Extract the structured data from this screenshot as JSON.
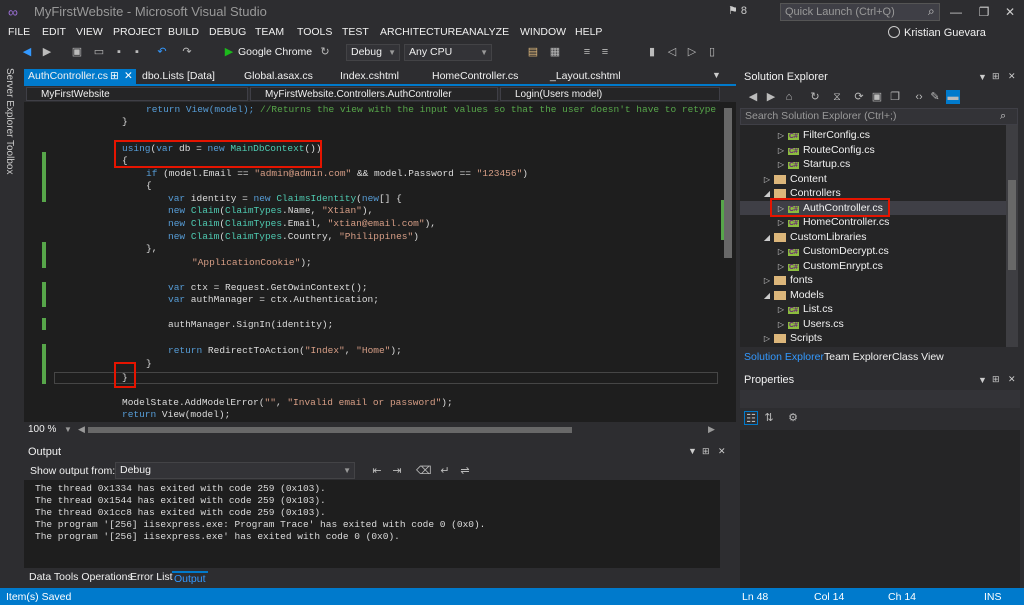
{
  "app": {
    "title": "MyFirstWebsite - Microsoft Visual Studio",
    "notifications": "8",
    "quick_launch_placeholder": "Quick Launch (Ctrl+Q)",
    "user": "Kristian Guevara"
  },
  "menu": [
    "FILE",
    "EDIT",
    "VIEW",
    "PROJECT",
    "BUILD",
    "DEBUG",
    "TEAM",
    "TOOLS",
    "TEST",
    "ARCHITECTURE",
    "ANALYZE",
    "WINDOW",
    "HELP"
  ],
  "toolbar": {
    "browser": "Google Chrome",
    "config": "Debug",
    "platform": "Any CPU"
  },
  "side_tabs": {
    "server_explorer": "Server Explorer",
    "toolbox": "Toolbox"
  },
  "tabs": [
    "AuthController.cs",
    "dbo.Lists [Data]",
    "Global.asax.cs",
    "Index.cshtml",
    "HomeController.cs",
    "_Layout.cshtml"
  ],
  "nav": {
    "project": "MyFirstWebsite",
    "class": "MyFirstWebsite.Controllers.AuthController",
    "member": "Login(Users model)"
  },
  "code": {
    "l1_a": "return View(model); ",
    "l1_b": "//Returns the view with the input values so that the user doesn't have to retype ag",
    "l2": "}",
    "l3_kw": "using",
    "l3_a": "(",
    "l3_var": "var",
    "l3_b": " db = ",
    "l3_new": "new",
    "l3_type": "MainDbContext",
    "l3_c": "())",
    "l4": "{",
    "l5_if": "if",
    "l5_a": " (model.Email == ",
    "l5_s1": "\"admin@admin.com\"",
    "l5_b": " && model.Password == ",
    "l5_s2": "\"123456\"",
    "l5_c": ")",
    "l6": "{",
    "l7_var": "var",
    "l7_a": " identity = ",
    "l7_new": "new",
    "l7_type": "ClaimsIdentity",
    "l7_b": "(",
    "l7_new2": "new",
    "l7_c": "[] {",
    "claims": [
      {
        "pre": "new",
        "type": "Claim",
        "a": "(",
        "ct": "ClaimTypes",
        ".": ".Name, ",
        "s": "\"Xtian\"",
        "end": "),"
      },
      {
        "pre": "new",
        "type": "Claim",
        "a": "(",
        "ct": "ClaimTypes",
        ".": ".Email, ",
        "s": "\"xtian@email.com\"",
        "end": "),"
      },
      {
        "pre": "new",
        "type": "Claim",
        "a": "(",
        "ct": "ClaimTypes",
        ".": ".Country, ",
        "s": "\"Philippines\"",
        "end": ")"
      }
    ],
    "l11": "},",
    "l12_s": "\"ApplicationCookie\"",
    "l12_b": ");",
    "l13_var": "var",
    "l13_a": " ctx = Request.GetOwinContext();",
    "l14_var": "var",
    "l14_a": " authManager = ctx.Authentication;",
    "l15": "authManager.SignIn(identity);",
    "l16_ret": "return",
    "l16_a": " RedirectToAction(",
    "l16_s1": "\"Index\"",
    "l16_b": ", ",
    "l16_s2": "\"Home\"",
    "l16_c": ");",
    "l17": "}",
    "l18": "}",
    "l19_a": "ModelState.AddModelError(",
    "l19_s1": "\"\"",
    "l19_b": ", ",
    "l19_s2": "\"Invalid email or password\"",
    "l19_c": ");",
    "l20_ret": "return",
    "l20_a": " View(model);"
  },
  "zoom": "100 %",
  "output": {
    "title": "Output",
    "show_from_label": "Show output from:",
    "source": "Debug",
    "lines": [
      "The thread 0x1334 has exited with code 259 (0x103).",
      "The thread 0x1544 has exited with code 259 (0x103).",
      "The thread 0x1cc8 has exited with code 259 (0x103).",
      "The program '[256] iisexpress.exe: Program Trace' has exited with code 0 (0x0).",
      "The program '[256] iisexpress.exe' has exited with code 0 (0x0)."
    ]
  },
  "bottom_tabs": [
    "Data Tools Operations",
    "Error List",
    "Output"
  ],
  "solution_explorer": {
    "title": "Solution Explorer",
    "search_placeholder": "Search Solution Explorer (Ctrl+;)",
    "items": [
      {
        "label": "FilterConfig.cs",
        "kind": "cs"
      },
      {
        "label": "RouteConfig.cs",
        "kind": "cs"
      },
      {
        "label": "Startup.cs",
        "kind": "cs"
      },
      {
        "label": "Content",
        "kind": "folder"
      },
      {
        "label": "Controllers",
        "kind": "folder-open"
      },
      {
        "label": "AuthController.cs",
        "kind": "cs"
      },
      {
        "label": "HomeController.cs",
        "kind": "cs"
      },
      {
        "label": "CustomLibraries",
        "kind": "folder-open"
      },
      {
        "label": "CustomDecrypt.cs",
        "kind": "cs"
      },
      {
        "label": "CustomEnrypt.cs",
        "kind": "cs"
      },
      {
        "label": "fonts",
        "kind": "folder"
      },
      {
        "label": "Models",
        "kind": "folder-open"
      },
      {
        "label": "List.cs",
        "kind": "cs"
      },
      {
        "label": "Users.cs",
        "kind": "cs"
      },
      {
        "label": "Scripts",
        "kind": "folder"
      }
    ],
    "bottom_tabs": [
      "Solution Explorer",
      "Team Explorer",
      "Class View"
    ]
  },
  "properties": {
    "title": "Properties"
  },
  "status": {
    "message": "Item(s) Saved",
    "line": "Ln 48",
    "col": "Col 14",
    "ch": "Ch 14",
    "mode": "INS"
  },
  "colors": {
    "accent": "#007acc",
    "highlight_box": "#e51400"
  }
}
